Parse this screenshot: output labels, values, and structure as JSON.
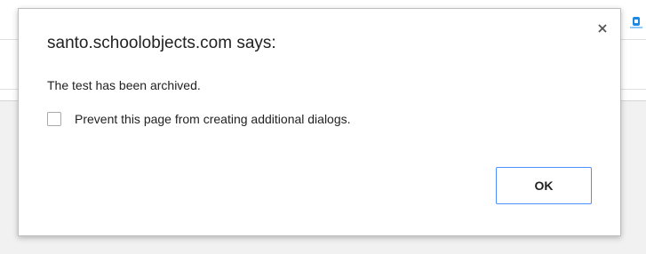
{
  "dialog": {
    "title": "santo.schoolobjects.com says:",
    "message": "The test has been archived.",
    "checkbox_label": "Prevent this page from creating additional dialogs.",
    "checkbox_checked": false,
    "ok_label": "OK",
    "close_symbol": "×"
  },
  "icons": {
    "close": "close-icon",
    "extension": "extension-icon"
  },
  "colors": {
    "ok_border": "#4d90fe",
    "text": "#222222",
    "background_band": "#f1f1f1"
  }
}
